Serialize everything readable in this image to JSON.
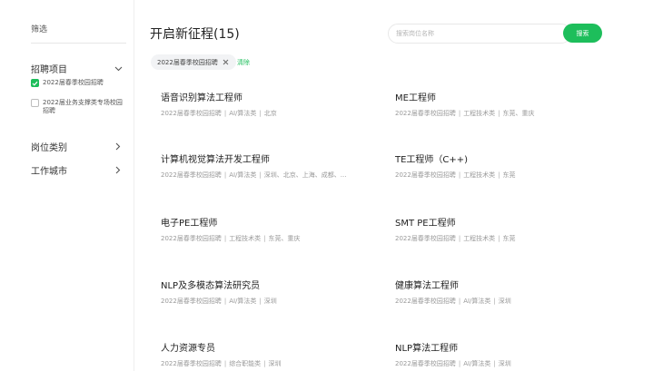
{
  "sidebar": {
    "title": "筛选",
    "sections": {
      "recruit": {
        "label": "招聘项目",
        "options": [
          {
            "label": "2022届春季校园招聘",
            "checked": true
          },
          {
            "label": "2022届业务支撑类专场校园招聘",
            "checked": false
          }
        ]
      },
      "category": {
        "label": "岗位类别"
      },
      "city": {
        "label": "工作城市"
      }
    }
  },
  "header": {
    "title": "开启新征程(15)",
    "search_placeholder": "搜索岗位名称",
    "search_button": "搜索"
  },
  "filters": {
    "active_tag": "2022届春季校园招聘",
    "clear_label": "清除"
  },
  "jobs": [
    {
      "title": "语音识别算法工程师",
      "project": "2022届春季校园招聘",
      "category": "AI/算法类",
      "cities": "北京"
    },
    {
      "title": "ME工程师",
      "project": "2022届春季校园招聘",
      "category": "工程技术类",
      "cities": "东莞、重庆"
    },
    {
      "title": "计算机视觉算法开发工程师",
      "project": "2022届春季校园招聘",
      "category": "AI/算法类",
      "cities": "深圳、北京、上海、成都、..."
    },
    {
      "title": "TE工程师（C++)",
      "project": "2022届春季校园招聘",
      "category": "工程技术类",
      "cities": "东莞"
    },
    {
      "title": "电子PE工程师",
      "project": "2022届春季校园招聘",
      "category": "工程技术类",
      "cities": "东莞、重庆"
    },
    {
      "title": "SMT PE工程师",
      "project": "2022届春季校园招聘",
      "category": "工程技术类",
      "cities": "东莞"
    },
    {
      "title": "NLP及多模态算法研究员",
      "project": "2022届春季校园招聘",
      "category": "AI/算法类",
      "cities": "深圳"
    },
    {
      "title": "健康算法工程师",
      "project": "2022届春季校园招聘",
      "category": "AI/算法类",
      "cities": "深圳"
    },
    {
      "title": "人力资源专员",
      "project": "2022届春季校园招聘",
      "category": "综合职能类",
      "cities": "深圳"
    },
    {
      "title": "NLP算法工程师",
      "project": "2022届春季校园招聘",
      "category": "AI/算法类",
      "cities": "深圳"
    }
  ],
  "colors": {
    "accent": "#1dbe5b",
    "text": "#222222",
    "muted": "#999999"
  }
}
